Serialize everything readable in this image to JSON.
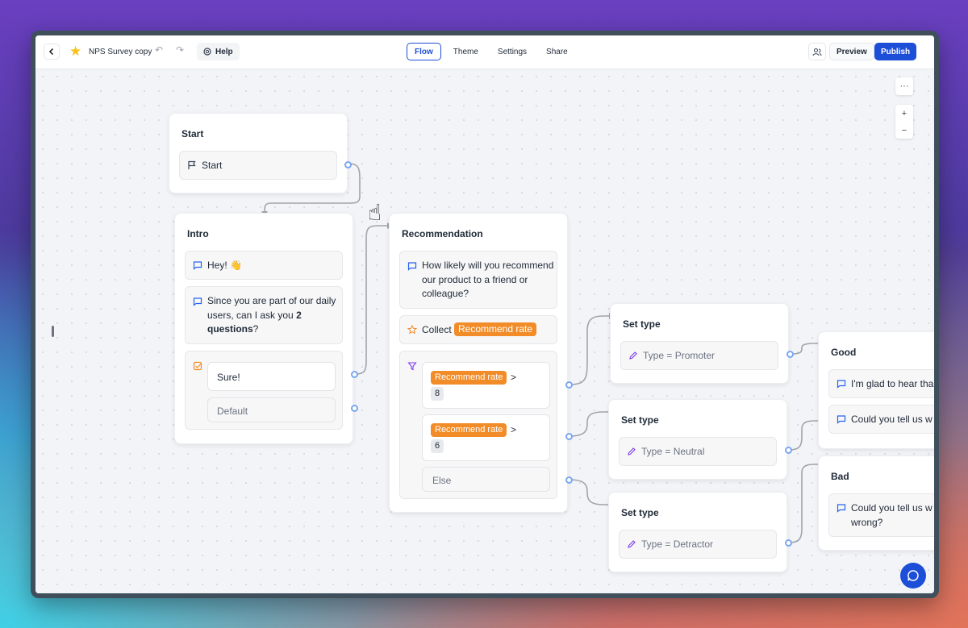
{
  "toolbar": {
    "title": "NPS Survey copy",
    "help_label": "Help",
    "tabs": [
      {
        "label": "Flow",
        "active": true
      },
      {
        "label": "Theme",
        "active": false
      },
      {
        "label": "Settings",
        "active": false
      },
      {
        "label": "Share",
        "active": false
      }
    ],
    "preview_label": "Preview",
    "publish_label": "Publish"
  },
  "canvas": {
    "more_label": "···",
    "zoom_in_label": "+",
    "zoom_out_label": "−"
  },
  "nodes": {
    "start": {
      "title": "Start",
      "block_label": "Start"
    },
    "intro": {
      "title": "Intro",
      "message1": "Hey! 👋",
      "message2_prefix": "Since you are part of our daily users, can I ask you ",
      "message2_bold": "2 questions",
      "message2_suffix": "?",
      "button1": "Sure!",
      "button2": "Default"
    },
    "recommendation": {
      "title": "Recommendation",
      "question": "How likely will you recommend our product to a friend or colleague?",
      "collect_label": "Collect",
      "collect_variable": "Recommend rate",
      "conditions": [
        {
          "variable": "Recommend rate",
          "operator": ">",
          "value": "8"
        },
        {
          "variable": "Recommend rate",
          "operator": ">",
          "value": "6"
        }
      ],
      "else_label": "Else"
    },
    "set_promoter": {
      "title": "Set type",
      "label": "Type = Promoter"
    },
    "set_neutral": {
      "title": "Set type",
      "label": "Type = Neutral"
    },
    "set_detractor": {
      "title": "Set type",
      "label": "Type = Detractor"
    },
    "good": {
      "title": "Good",
      "message1": "I'm glad to hear tha",
      "message2": "Could you tell us w"
    },
    "bad": {
      "title": "Bad",
      "message1": "Could you tell us w wrong?"
    }
  },
  "colors": {
    "accent": "#1d4ed8",
    "variable_pill": "#f28c28",
    "port": "#7aa7f0"
  }
}
